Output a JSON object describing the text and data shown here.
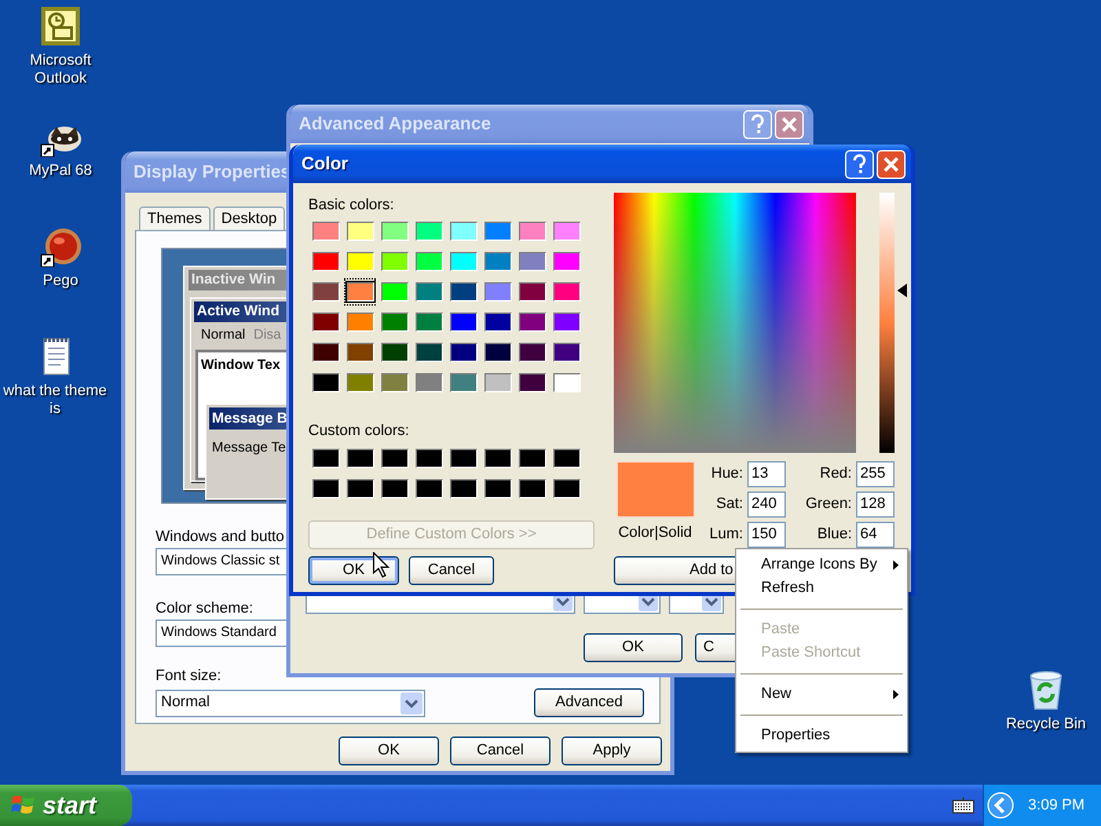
{
  "desktop_icons": [
    {
      "kind": "outlook",
      "label": "Microsoft Outlook"
    },
    {
      "kind": "animal",
      "label": "MyPal 68"
    },
    {
      "kind": "ball",
      "label": "Pego"
    },
    {
      "kind": "notepad",
      "label": "what the theme is"
    },
    {
      "kind": "recycle",
      "label": "Recycle Bin"
    }
  ],
  "display_properties": {
    "title": "Display Properties",
    "tabs": [
      {
        "label": "Themes",
        "selected": false
      },
      {
        "label": "Desktop",
        "selected": false
      }
    ],
    "preview": {
      "inactive_title": "Inactive Win",
      "active_title": "Active Wind",
      "menu": [
        {
          "label": "Normal",
          "disabled": false
        },
        {
          "label": "Disa",
          "disabled": true
        }
      ],
      "window_text": "Window Tex",
      "message_title": "Message B",
      "message_text": "Message Te"
    },
    "fields": [
      {
        "label": "Windows and butto",
        "value": "Windows Classic st"
      },
      {
        "label": "Color scheme:",
        "value": "Windows Standard"
      }
    ],
    "font_size": {
      "label": "Font size:",
      "value": "Normal"
    },
    "advanced_button": "Advanced",
    "buttons": [
      "OK",
      "Cancel",
      "Apply"
    ]
  },
  "advanced_appearance": {
    "title": "Advanced Appearance",
    "buttons": [
      "OK",
      "C"
    ]
  },
  "color_dialog": {
    "title": "Color",
    "basic_colors_label": "Basic colors:",
    "basic_colors": [
      {
        "color": "#ff8080",
        "selected": false
      },
      {
        "color": "#ffff80",
        "selected": false
      },
      {
        "color": "#80ff80",
        "selected": false
      },
      {
        "color": "#00ff80",
        "selected": false
      },
      {
        "color": "#80ffff",
        "selected": false
      },
      {
        "color": "#0080ff",
        "selected": false
      },
      {
        "color": "#ff80c0",
        "selected": false
      },
      {
        "color": "#ff80ff",
        "selected": false
      },
      {
        "color": "#ff0000",
        "selected": false
      },
      {
        "color": "#ffff00",
        "selected": false
      },
      {
        "color": "#80ff00",
        "selected": false
      },
      {
        "color": "#00ff40",
        "selected": false
      },
      {
        "color": "#00ffff",
        "selected": false
      },
      {
        "color": "#0080c0",
        "selected": false
      },
      {
        "color": "#8080c0",
        "selected": false
      },
      {
        "color": "#ff00ff",
        "selected": false
      },
      {
        "color": "#804040",
        "selected": false
      },
      {
        "color": "#ff8040",
        "selected": true
      },
      {
        "color": "#00ff00",
        "selected": false
      },
      {
        "color": "#008080",
        "selected": false
      },
      {
        "color": "#004080",
        "selected": false
      },
      {
        "color": "#8080ff",
        "selected": false
      },
      {
        "color": "#800040",
        "selected": false
      },
      {
        "color": "#ff0080",
        "selected": false
      },
      {
        "color": "#800000",
        "selected": false
      },
      {
        "color": "#ff8000",
        "selected": false
      },
      {
        "color": "#008000",
        "selected": false
      },
      {
        "color": "#008040",
        "selected": false
      },
      {
        "color": "#0000ff",
        "selected": false
      },
      {
        "color": "#0000a0",
        "selected": false
      },
      {
        "color": "#800080",
        "selected": false
      },
      {
        "color": "#8000ff",
        "selected": false
      },
      {
        "color": "#400000",
        "selected": false
      },
      {
        "color": "#804000",
        "selected": false
      },
      {
        "color": "#004000",
        "selected": false
      },
      {
        "color": "#004040",
        "selected": false
      },
      {
        "color": "#000080",
        "selected": false
      },
      {
        "color": "#000040",
        "selected": false
      },
      {
        "color": "#400040",
        "selected": false
      },
      {
        "color": "#400080",
        "selected": false
      },
      {
        "color": "#000000",
        "selected": false
      },
      {
        "color": "#808000",
        "selected": false
      },
      {
        "color": "#808040",
        "selected": false
      },
      {
        "color": "#808080",
        "selected": false
      },
      {
        "color": "#408080",
        "selected": false
      },
      {
        "color": "#c0c0c0",
        "selected": false
      },
      {
        "color": "#400040",
        "selected": false
      },
      {
        "color": "#ffffff",
        "selected": false
      }
    ],
    "custom_colors_label": "Custom colors:",
    "custom_colors": [
      {
        "color": "#000000"
      },
      {
        "color": "#000000"
      },
      {
        "color": "#000000"
      },
      {
        "color": "#000000"
      },
      {
        "color": "#000000"
      },
      {
        "color": "#000000"
      },
      {
        "color": "#000000"
      },
      {
        "color": "#000000"
      },
      {
        "color": "#000000"
      },
      {
        "color": "#000000"
      },
      {
        "color": "#000000"
      },
      {
        "color": "#000000"
      },
      {
        "color": "#000000"
      },
      {
        "color": "#000000"
      },
      {
        "color": "#000000"
      },
      {
        "color": "#000000"
      }
    ],
    "define_button": {
      "label": "Define Custom Colors >>",
      "disabled": true
    },
    "buttons": [
      {
        "label": "OK",
        "default": true
      },
      {
        "label": "Cancel",
        "default": false
      }
    ],
    "luminance": {
      "level": 0.625
    },
    "preview_label": "Color|Solid",
    "hsl": [
      {
        "label": "Hue:",
        "value": "13"
      },
      {
        "label": "Sat:",
        "value": "240"
      },
      {
        "label": "Lum:",
        "value": "150"
      }
    ],
    "rgb": [
      {
        "label": "Red:",
        "value": "255"
      },
      {
        "label": "Green:",
        "value": "128"
      },
      {
        "label": "Blue:",
        "value": "64"
      }
    ],
    "add_button": "Add to"
  },
  "context_menu": [
    {
      "kind": "item",
      "label": "Arrange Icons By",
      "submenu": true,
      "disabled": false
    },
    {
      "kind": "item",
      "label": "Refresh",
      "submenu": false,
      "disabled": false
    },
    {
      "kind": "separator"
    },
    {
      "kind": "item",
      "label": "Paste",
      "submenu": false,
      "disabled": true
    },
    {
      "kind": "item",
      "label": "Paste Shortcut",
      "submenu": false,
      "disabled": true
    },
    {
      "kind": "separator"
    },
    {
      "kind": "item",
      "label": "New",
      "submenu": true,
      "disabled": false
    },
    {
      "kind": "separator"
    },
    {
      "kind": "item",
      "label": "Properties",
      "submenu": false,
      "disabled": false
    }
  ],
  "taskbar": {
    "start": "start",
    "clock": "3:09 PM"
  }
}
